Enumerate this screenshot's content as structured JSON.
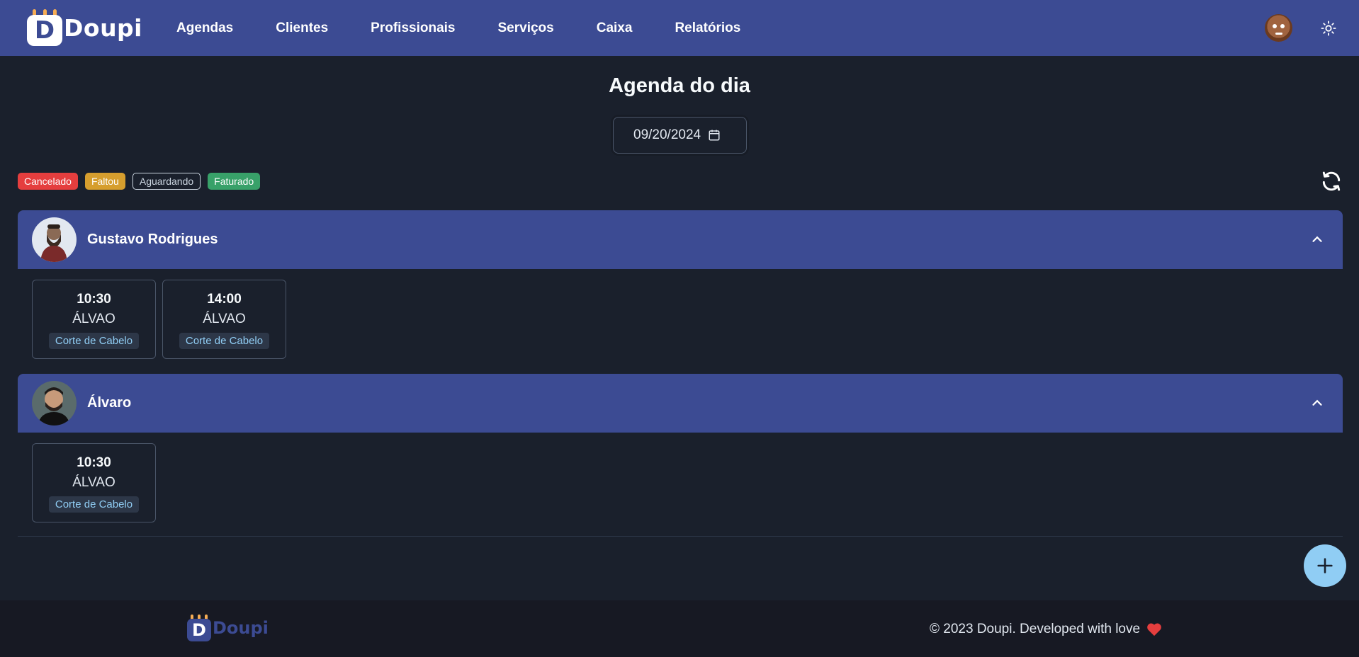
{
  "app": {
    "brand": "Doupi",
    "brand_letter": "D"
  },
  "nav": {
    "items": [
      "Agendas",
      "Clientes",
      "Profissionais",
      "Serviços",
      "Caixa",
      "Relatórios"
    ]
  },
  "page": {
    "title": "Agenda do dia",
    "date": "09/20/2024"
  },
  "legend": {
    "cancelado": "Cancelado",
    "faltou": "Faltou",
    "aguardando": "Aguardando",
    "faturado": "Faturado"
  },
  "colors": {
    "primary": "#3c4b93",
    "background": "#1a202c",
    "cancelado": "#e53e3e",
    "faltou": "#d69e2e",
    "faturado": "#38a169",
    "fab": "#90cdf4"
  },
  "professionals": [
    {
      "name": "Gustavo Rodrigues",
      "appointments": [
        {
          "time": "10:30",
          "client": "ÁLVAO",
          "service": "Corte de Cabelo"
        },
        {
          "time": "14:00",
          "client": "ÁLVAO",
          "service": "Corte de Cabelo"
        }
      ]
    },
    {
      "name": "Álvaro",
      "appointments": [
        {
          "time": "10:30",
          "client": "ÁLVAO",
          "service": "Corte de Cabelo"
        }
      ]
    }
  ],
  "footer": {
    "brand": "Doupi",
    "brand_letter": "D",
    "copyright": "© 2023 Doupi. Developed with love"
  }
}
